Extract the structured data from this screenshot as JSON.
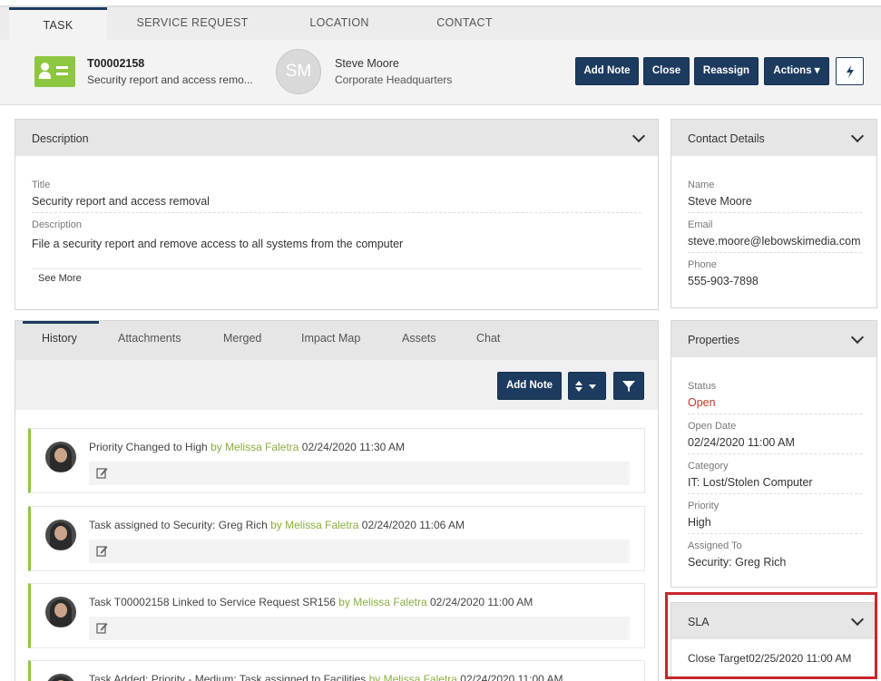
{
  "top_tabs": [
    "TASK",
    "SERVICE REQUEST",
    "LOCATION",
    "CONTACT"
  ],
  "header": {
    "task_id": "T00002158",
    "task_summary": "Security report and access remo...",
    "avatar_initials": "SM",
    "contact_name": "Steve Moore",
    "contact_location": "Corporate Headquarters",
    "buttons": {
      "add_note": "Add Note",
      "close": "Close",
      "reassign": "Reassign",
      "actions": "Actions ▾"
    }
  },
  "description": {
    "title": "Description",
    "title_label": "Title",
    "title_value": "Security report and access removal",
    "desc_label": "Description",
    "desc_value": "File a security report and remove access to all systems from the computer",
    "see_more": "See More"
  },
  "history": {
    "tabs": [
      "History",
      "Attachments",
      "Merged",
      "Impact Map",
      "Assets",
      "Chat"
    ],
    "add_note": "Add Note",
    "items": [
      {
        "text": "Priority Changed to High ",
        "by": "by Melissa Faletra",
        "time": " 02/24/2020 11:30 AM"
      },
      {
        "text": "Task assigned to Security: Greg Rich ",
        "by": "by Melissa Faletra",
        "time": " 02/24/2020 11:06 AM"
      },
      {
        "text": "Task T00002158 Linked to Service Request SR156 ",
        "by": "by Melissa Faletra",
        "time": " 02/24/2020 11:00 AM"
      },
      {
        "text": "Task Added: Priority - Medium; Task assigned to Facilities ",
        "by": "by Melissa Faletra",
        "time": " 02/24/2020 11:00 AM"
      }
    ]
  },
  "contact": {
    "title": "Contact Details",
    "name_label": "Name",
    "name": "Steve Moore",
    "email_label": "Email",
    "email": "steve.moore@lebowskimedia.com",
    "phone_label": "Phone",
    "phone": "555-903-7898"
  },
  "properties": {
    "title": "Properties",
    "status_label": "Status",
    "status": "Open",
    "status_color": "#c0392b",
    "open_date_label": "Open Date",
    "open_date": "02/24/2020 11:00 AM",
    "category_label": "Category",
    "category": "IT: Lost/Stolen Computer",
    "priority_label": "Priority",
    "priority": "High",
    "assigned_label": "Assigned To",
    "assigned": "Security: Greg Rich"
  },
  "sla": {
    "title": "SLA",
    "close_target_label": "Close Target",
    "close_target": "02/25/2020 11:00 AM"
  },
  "colors": {
    "brand": "#1d3b5f",
    "accent_green": "#8dc63f",
    "highlight_red": "#c8262c"
  }
}
